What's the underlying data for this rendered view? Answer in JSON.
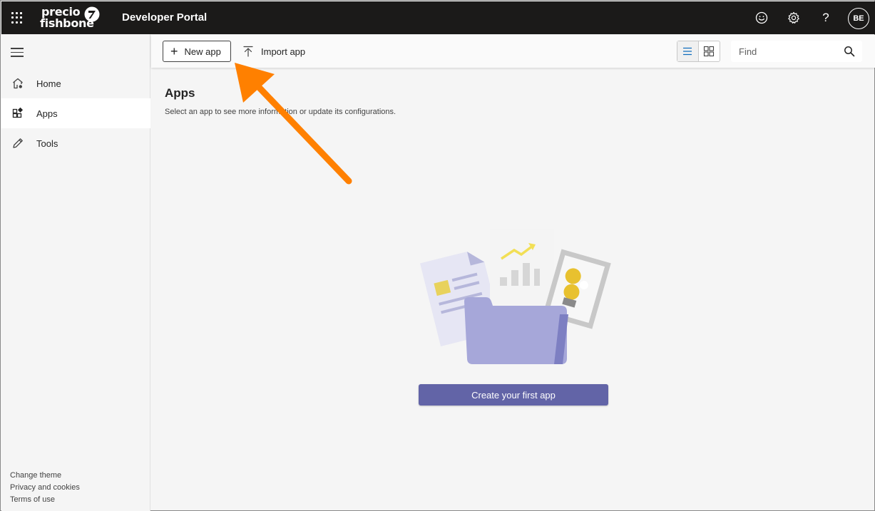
{
  "header": {
    "logo_line1": "precio",
    "logo_line2": "fishbone",
    "title": "Developer Portal",
    "icons": [
      "waffle-icon",
      "smiley-icon",
      "gear-icon",
      "help-icon"
    ],
    "help_glyph": "?",
    "avatar_initials": "BE"
  },
  "sidebar": {
    "items": [
      {
        "label": "Home",
        "icon": "home-icon"
      },
      {
        "label": "Apps",
        "icon": "apps-icon",
        "active": true
      },
      {
        "label": "Tools",
        "icon": "pencil-icon"
      }
    ],
    "footer": [
      "Change theme",
      "Privacy and cookies",
      "Terms of use"
    ]
  },
  "toolbar": {
    "new_app_label": "New app",
    "import_app_label": "Import app",
    "search_placeholder": "Find"
  },
  "main": {
    "title": "Apps",
    "subtitle": "Select an app to see more information or update its configurations.",
    "create_button_label": "Create your first app"
  },
  "colors": {
    "topbar": "#1b1a19",
    "accent": "#6264a7",
    "annotation_arrow": "#ff8000"
  }
}
